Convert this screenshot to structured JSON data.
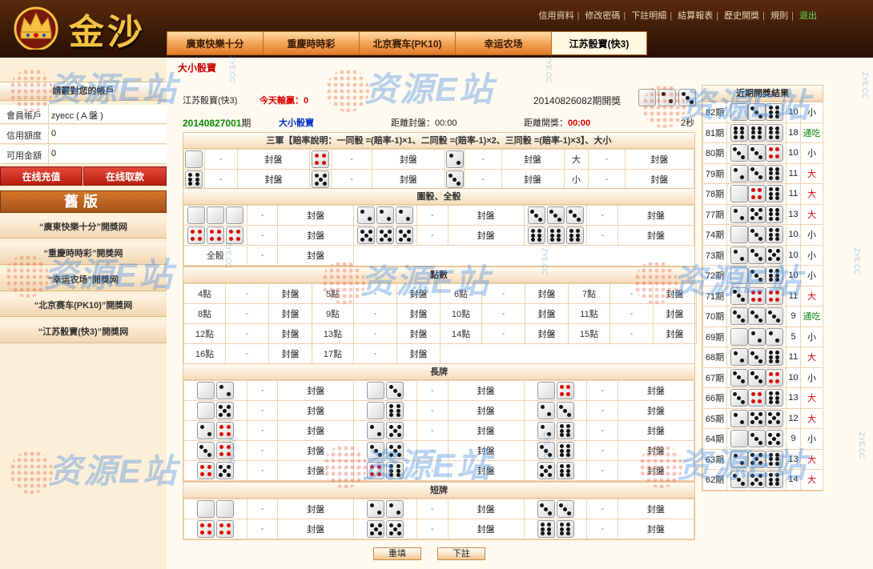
{
  "app": {
    "logo_text": "金沙"
  },
  "top_links": {
    "items": [
      "信用資料",
      "修改密碼",
      "下註明細",
      "結算報表",
      "歷史開獎",
      "規則"
    ],
    "logout": "退出"
  },
  "tabs": [
    "廣東快樂十分",
    "重慶時時彩",
    "北京赛车(PK10)",
    "幸运农场",
    "江苏骰寶(快3)"
  ],
  "active_tab": 4,
  "sidebar": {
    "confirm": "請覈對您的帳戶",
    "account": [
      {
        "key": "會員帳戶",
        "value": "zyecc ( A 盤 )"
      },
      {
        "key": "信用額度",
        "value": "0"
      },
      {
        "key": "可用金額",
        "value": "0"
      }
    ],
    "recharge": "在线充值",
    "withdraw": "在线取款",
    "old_version": "舊版",
    "links": [
      "“廣東快樂十分”開獎网",
      "“重慶時時彩”開獎网",
      "“幸运农场”開獎网",
      "“北京赛车(PK10)”開獎网",
      "“江苏骰寶(快3)”開獎网"
    ]
  },
  "main": {
    "title": "大小骰寶",
    "game": "江苏骰寶(快3)",
    "today_label": "今天輸贏：",
    "today_value": "0",
    "last_period": "20140826082期開獎",
    "current_period": "20140827001",
    "period_suffix": "期",
    "mode": "大小骰寶",
    "close_label": "距離封盤：",
    "close_time": "00:00",
    "open_label": "距離開獎：",
    "open_time": "00:00",
    "refresh": "2秒",
    "current_dice": [
      1,
      2,
      3
    ]
  },
  "sections": {
    "sanjun": "三軍【賠率說明：一同骰 =(賠率-1)×1、二同骰 =(賠率-1)×2、三同骰 =(賠率-1)×3】、大小",
    "weishai": "圍骰、全骰",
    "dianshu": "點數",
    "changpai": "長牌",
    "duanpai": "短牌"
  },
  "odds_placeholder": "-",
  "closed_label": "封盤",
  "sanjun_rows": [
    [
      {
        "dice": [
          1
        ]
      },
      {
        "dice": [
          4
        ]
      },
      {
        "dice": [
          2
        ]
      },
      {
        "text": "大"
      }
    ],
    [
      {
        "dice": [
          6
        ]
      },
      {
        "dice": [
          5
        ]
      },
      {
        "dice": [
          3
        ]
      },
      {
        "text": "小"
      }
    ]
  ],
  "weishai_rows": [
    [
      [
        1,
        1,
        1
      ],
      [
        2,
        2,
        2
      ],
      [
        3,
        3,
        3
      ]
    ],
    [
      [
        4,
        4,
        4
      ],
      [
        5,
        5,
        5
      ],
      [
        6,
        6,
        6
      ]
    ]
  ],
  "quanshai_label": "全骰",
  "points": [
    [
      "4點",
      "5點",
      "6點",
      "7點"
    ],
    [
      "8點",
      "9點",
      "10點",
      "11點"
    ],
    [
      "12點",
      "13點",
      "14點",
      "15點"
    ],
    [
      "16點",
      "17點"
    ]
  ],
  "long_rows": [
    [
      [
        1,
        2
      ],
      [
        1,
        3
      ],
      [
        1,
        4
      ]
    ],
    [
      [
        1,
        5
      ],
      [
        1,
        6
      ],
      [
        2,
        3
      ]
    ],
    [
      [
        2,
        4
      ],
      [
        2,
        5
      ],
      [
        2,
        6
      ]
    ],
    [
      [
        3,
        4
      ],
      [
        3,
        5
      ],
      [
        3,
        6
      ]
    ],
    [
      [
        4,
        5
      ],
      [
        4,
        6
      ],
      [
        5,
        6
      ]
    ]
  ],
  "short_rows": [
    [
      [
        1,
        1
      ],
      [
        2,
        2
      ],
      [
        3,
        3
      ]
    ],
    [
      [
        4,
        4
      ],
      [
        5,
        5
      ],
      [
        6,
        6
      ]
    ]
  ],
  "history": {
    "title": "近期開獎結果",
    "rows": [
      {
        "period": "82期",
        "dice": [
          1,
          3,
          6
        ],
        "sum": "10",
        "result": "小",
        "kind": "small"
      },
      {
        "period": "81期",
        "dice": [
          6,
          6,
          6
        ],
        "sum": "18",
        "result": "通吃",
        "kind": "tong"
      },
      {
        "period": "80期",
        "dice": [
          3,
          3,
          4
        ],
        "sum": "10",
        "result": "小",
        "kind": "small"
      },
      {
        "period": "79期",
        "dice": [
          2,
          3,
          6
        ],
        "sum": "11",
        "result": "大",
        "kind": "big"
      },
      {
        "period": "78期",
        "dice": [
          1,
          4,
          6
        ],
        "sum": "11",
        "result": "大",
        "kind": "big"
      },
      {
        "period": "77期",
        "dice": [
          2,
          5,
          6
        ],
        "sum": "13",
        "result": "大",
        "kind": "big"
      },
      {
        "period": "74期",
        "dice": [
          1,
          3,
          6
        ],
        "sum": "10",
        "result": "小",
        "kind": "small"
      },
      {
        "period": "73期",
        "dice": [
          2,
          3,
          5
        ],
        "sum": "10",
        "result": "小",
        "kind": "small"
      },
      {
        "period": "72期",
        "dice": [
          1,
          3,
          6
        ],
        "sum": "10",
        "result": "小",
        "kind": "small"
      },
      {
        "period": "71期",
        "dice": [
          3,
          4,
          4
        ],
        "sum": "11",
        "result": "大",
        "kind": "big"
      },
      {
        "period": "70期",
        "dice": [
          3,
          3,
          3
        ],
        "sum": "9",
        "result": "通吃",
        "kind": "tong"
      },
      {
        "period": "69期",
        "dice": [
          1,
          2,
          2
        ],
        "sum": "5",
        "result": "小",
        "kind": "small"
      },
      {
        "period": "68期",
        "dice": [
          2,
          3,
          6
        ],
        "sum": "11",
        "result": "大",
        "kind": "big"
      },
      {
        "period": "67期",
        "dice": [
          3,
          3,
          4
        ],
        "sum": "10",
        "result": "小",
        "kind": "small"
      },
      {
        "period": "66期",
        "dice": [
          3,
          4,
          6
        ],
        "sum": "13",
        "result": "大",
        "kind": "big"
      },
      {
        "period": "65期",
        "dice": [
          2,
          5,
          5
        ],
        "sum": "12",
        "result": "大",
        "kind": "big"
      },
      {
        "period": "64期",
        "dice": [
          1,
          3,
          5
        ],
        "sum": "9",
        "result": "小",
        "kind": "small"
      },
      {
        "period": "63期",
        "dice": [
          2,
          5,
          6
        ],
        "sum": "13",
        "result": "大",
        "kind": "big"
      },
      {
        "period": "62期",
        "dice": [
          3,
          5,
          6
        ],
        "sum": "14",
        "result": "大",
        "kind": "big"
      }
    ]
  },
  "buttons": {
    "reset": "重填",
    "submit": "下註"
  },
  "watermark": {
    "text": "资源E站",
    "side": "ZYE.CC"
  },
  "colors": {
    "accent": "#e07c2a",
    "header": "#3a1a06",
    "red": "#d00000",
    "green": "#0a8a0a"
  }
}
